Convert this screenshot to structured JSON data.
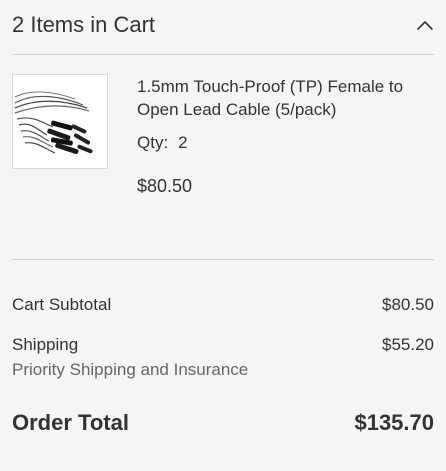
{
  "minicart": {
    "header": {
      "title": "2 Items in Cart",
      "toggle_icon": "chevron-up-icon"
    },
    "items": [
      {
        "image_alt": "cable-bundle-thumbnail",
        "name": "1.5mm Touch-Proof (TP) Female to Open Lead Cable (5/pack)",
        "qty_label": "Qty:",
        "qty_value": "2",
        "price": "$80.50"
      }
    ]
  },
  "totals": {
    "subtotal_label": "Cart Subtotal",
    "subtotal_value": "$80.50",
    "shipping_label": "Shipping",
    "shipping_value": "$55.20",
    "shipping_method": "Priority Shipping and Insurance",
    "order_total_label": "Order Total",
    "order_total_value": "$135.70"
  },
  "colors": {
    "text": "#333333",
    "muted_text": "#666666",
    "divider": "#d1d1d1",
    "background": "#f5f5f5"
  }
}
